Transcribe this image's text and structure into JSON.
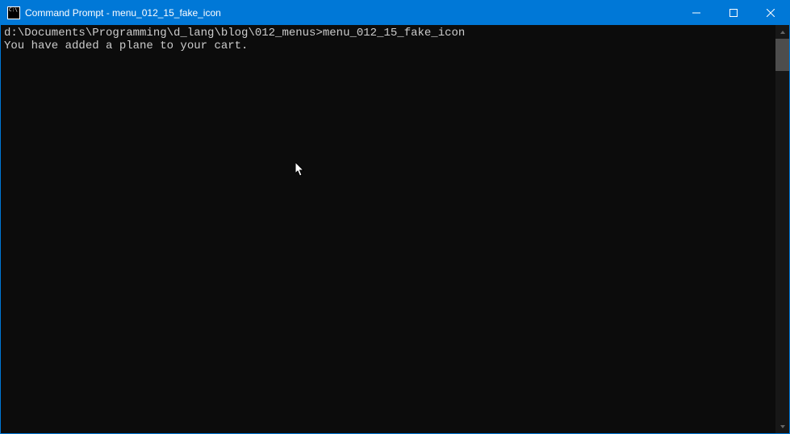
{
  "window": {
    "title": "Command Prompt - menu_012_15_fake_icon"
  },
  "terminal": {
    "prompt_path": "d:\\Documents\\Programming\\d_lang\\blog\\012_menus>",
    "command": "menu_012_15_fake_icon",
    "output_line_1": "You have added a plane to your cart."
  }
}
